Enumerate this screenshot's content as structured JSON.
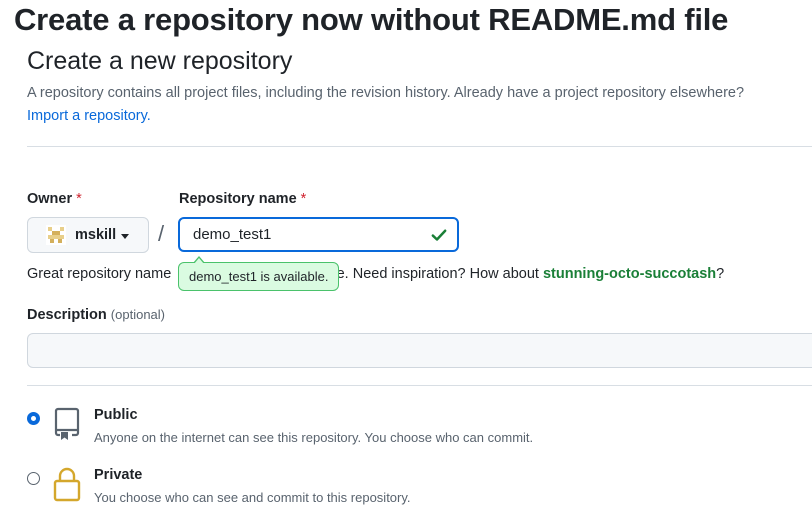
{
  "banner": {
    "title": "Create a repository now without README.md file"
  },
  "header": {
    "title": "Create a new repository",
    "subtitle": "A repository contains all project files, including the revision history. Already have a project repository elsewhere?",
    "import_link": "Import a repository."
  },
  "form": {
    "owner_label": "Owner",
    "required_mark": "*",
    "owner_value": "mskill",
    "slash": "/",
    "repo_label": "Repository name",
    "repo_value": "demo_test1",
    "availability_tooltip": "demo_test1 is available.",
    "hint_prefix": "Great repository name",
    "hint_middle": "able. Need inspiration? How about",
    "hint_suggestion": "stunning-octo-succotash",
    "hint_suffix": "?",
    "description_label": "Description",
    "description_optional": "(optional)",
    "description_value": ""
  },
  "visibility": {
    "selected": "public",
    "options": [
      {
        "id": "public",
        "title": "Public",
        "description": "Anyone on the internet can see this repository. You choose who can commit.",
        "icon": "repo-icon"
      },
      {
        "id": "private",
        "title": "Private",
        "description": "You choose who can see and commit to this repository.",
        "icon": "lock-icon"
      }
    ]
  },
  "colors": {
    "accent": "#0969da",
    "success": "#1a7f37",
    "success_bg": "#dafbe1",
    "danger": "#cf222e",
    "muted": "#59636e"
  }
}
